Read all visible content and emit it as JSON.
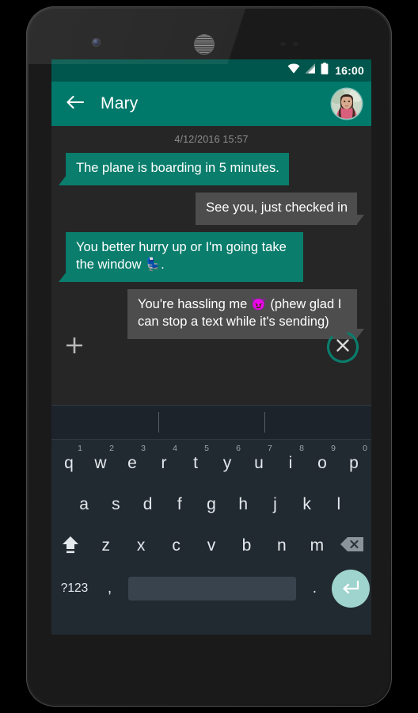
{
  "device": {
    "front_camera": "front-camera",
    "earpiece": "earpiece-speaker",
    "sensors": "proximity-sensors"
  },
  "status_bar": {
    "time": "16:00",
    "wifi_icon": "wifi-icon",
    "signal_icon": "cellular-signal-icon",
    "battery_icon": "battery-icon",
    "background_color": "#00564c"
  },
  "app_bar": {
    "back_icon": "back-arrow-icon",
    "title": "Mary",
    "avatar_label": "contact-avatar",
    "background_color": "#00796b"
  },
  "conversation": {
    "timestamp": "4/12/2016 15:57",
    "messages": [
      {
        "id": "msg-1",
        "direction": "incoming",
        "text": "The plane is boarding in 5 minutes.",
        "bubble_color": "#0a7d6c"
      },
      {
        "id": "msg-2",
        "direction": "outgoing",
        "text": "See you, just checked in",
        "bubble_color": "#4d4d4d"
      },
      {
        "id": "msg-3",
        "direction": "incoming",
        "text_before": "You better hurry up or I'm going take the window ",
        "emoji": "💺",
        "text_after": ".",
        "bubble_color": "#0a7d6c"
      },
      {
        "id": "msg-4",
        "direction": "outgoing",
        "text_before": "You're hassling me ",
        "emoji": "😈",
        "text_after": " (phew glad I can stop a text while it's sending)",
        "bubble_color": "#4d4d4d"
      }
    ]
  },
  "compose_bar": {
    "attach_icon": "plus-attachment-icon",
    "cancel_send_icon": "cancel-send-icon",
    "progress_color": "#0a7d6c"
  },
  "keyboard": {
    "suggestions": [
      "",
      "",
      ""
    ],
    "row1": [
      {
        "key": "q",
        "num": "1"
      },
      {
        "key": "w",
        "num": "2"
      },
      {
        "key": "e",
        "num": "3"
      },
      {
        "key": "r",
        "num": "4"
      },
      {
        "key": "t",
        "num": "5"
      },
      {
        "key": "y",
        "num": "6"
      },
      {
        "key": "u",
        "num": "7"
      },
      {
        "key": "i",
        "num": "8"
      },
      {
        "key": "o",
        "num": "9"
      },
      {
        "key": "p",
        "num": "0"
      }
    ],
    "row2": [
      "a",
      "s",
      "d",
      "f",
      "g",
      "h",
      "j",
      "k",
      "l"
    ],
    "row3": {
      "shift_icon": "shift-key-icon",
      "letters": [
        "z",
        "x",
        "c",
        "v",
        "b",
        "n",
        "m"
      ],
      "backspace_icon": "backspace-key-icon"
    },
    "row4": {
      "symbols_label": "?123",
      "comma": ",",
      "spacebar": "space-key",
      "period": ".",
      "enter_icon": "enter-key-icon",
      "enter_color": "#9ed4cd"
    },
    "background_color": "#222a31"
  }
}
